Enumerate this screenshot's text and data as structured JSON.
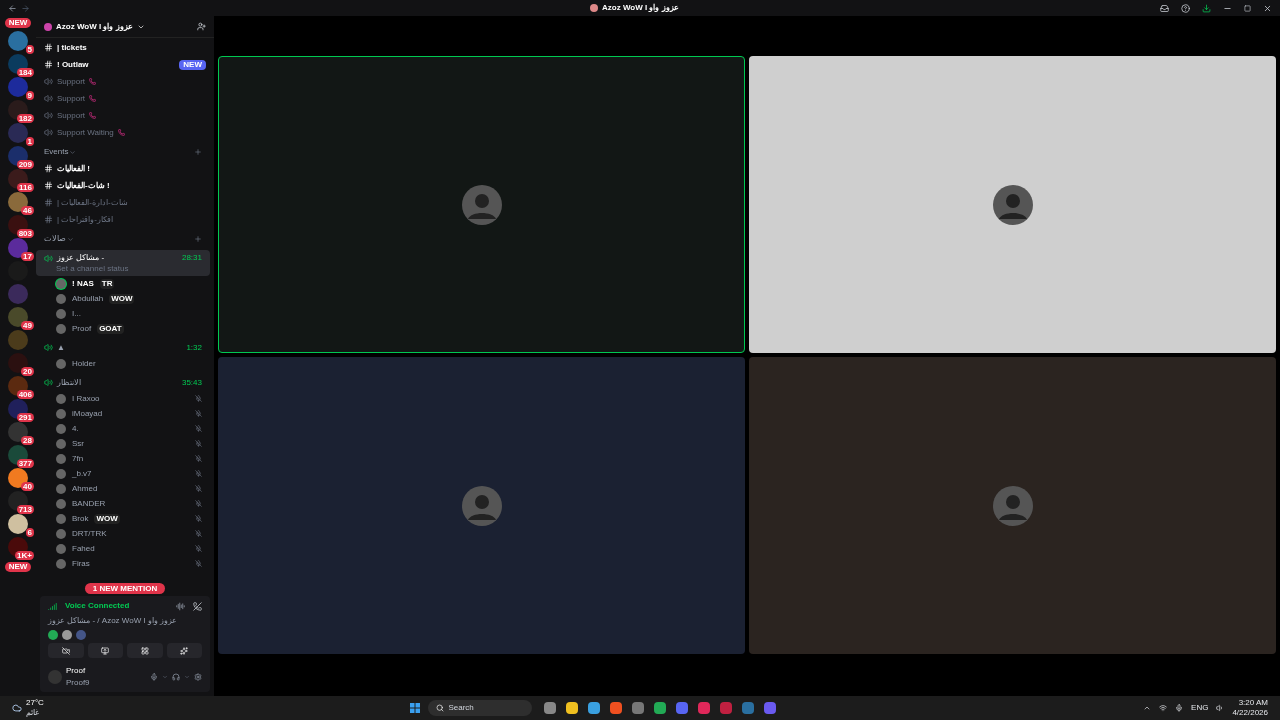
{
  "window": {
    "title": "Azoz WoW I عزوز واو"
  },
  "rail": {
    "top_pill": "NEW",
    "bottom_pill": "NEW",
    "servers": [
      {
        "kind": "badged",
        "badge": "5"
      },
      {
        "kind": "badged",
        "badge": "184"
      },
      {
        "kind": "badged",
        "badge": "9"
      },
      {
        "kind": "badged",
        "badge": "182"
      },
      {
        "kind": "badged",
        "badge": "1"
      },
      {
        "kind": "badged",
        "badge": "209"
      },
      {
        "kind": "badged",
        "badge": "116"
      },
      {
        "kind": "badged",
        "badge": "46"
      },
      {
        "kind": "badged",
        "badge": "803"
      },
      {
        "kind": "badged",
        "badge": "17"
      },
      {
        "kind": "plain"
      },
      {
        "kind": "plain"
      },
      {
        "kind": "badged",
        "badge": "49"
      },
      {
        "kind": "plain"
      },
      {
        "kind": "badged",
        "badge": "20"
      },
      {
        "kind": "badged",
        "badge": "406"
      },
      {
        "kind": "badged",
        "badge": "291"
      },
      {
        "kind": "badged",
        "badge": "28"
      },
      {
        "kind": "badged",
        "badge": "377"
      },
      {
        "kind": "badged",
        "badge": "40"
      },
      {
        "kind": "badged",
        "badge": "713"
      },
      {
        "kind": "badged",
        "badge": "6"
      },
      {
        "kind": "badged",
        "badge": "1K+"
      }
    ]
  },
  "server_header": {
    "name": "Azoz WoW I عزوز واو"
  },
  "channels": [
    {
      "kind": "text",
      "name": "| tickets",
      "unread": true
    },
    {
      "kind": "text",
      "name": "! Outlaw",
      "unread": true,
      "badge": "NEW"
    },
    {
      "kind": "voice",
      "name": "Support",
      "unread": false
    },
    {
      "kind": "voice",
      "name": "Support",
      "unread": false
    },
    {
      "kind": "voice",
      "name": "Support",
      "unread": false
    },
    {
      "kind": "voice",
      "name": "Support Waiting",
      "unread": false
    },
    {
      "kind": "category",
      "name": "Events"
    },
    {
      "kind": "text",
      "name": "الفعاليات !",
      "unread": true
    },
    {
      "kind": "text",
      "name": "شات-الفعاليات !",
      "unread": true
    },
    {
      "kind": "text",
      "name": "| شات-ادارة-الفعاليات",
      "unread": false
    },
    {
      "kind": "text",
      "name": "| افكار-واقتراحات",
      "unread": false
    },
    {
      "kind": "category",
      "name": "صالات"
    },
    {
      "kind": "voicelive",
      "name": "مشاكل عزوز -",
      "timer": "28:31",
      "selected": true,
      "status": "Set a channel status",
      "users": [
        {
          "name": "! NAS",
          "tag": "TR",
          "muted": false,
          "speaking": true
        },
        {
          "name": "Abdullah",
          "tag": "WOW",
          "muted": false,
          "speaking": false
        },
        {
          "name": "I...",
          "muted": false,
          "speaking": false
        },
        {
          "name": "Proof",
          "tag": "GOAT",
          "muted": false,
          "speaking": false
        }
      ]
    },
    {
      "kind": "voicelive",
      "name": "▲",
      "timer": "1:32",
      "selected": false,
      "users": [
        {
          "name": "Holder",
          "muted": false,
          "speaking": false
        }
      ]
    },
    {
      "kind": "voicelive",
      "name": "الانتظار",
      "timer": "35:43",
      "selected": false,
      "users": [
        {
          "name": "I Raxoo",
          "muted": true,
          "speaking": false
        },
        {
          "name": "iMoayad",
          "muted": true,
          "speaking": false
        },
        {
          "name": "4.",
          "muted": true,
          "speaking": false
        },
        {
          "name": "Ssr",
          "muted": true,
          "speaking": false
        },
        {
          "name": "7fn",
          "muted": true,
          "speaking": false
        },
        {
          "name": "_b.v7",
          "muted": true,
          "speaking": false
        },
        {
          "name": "Ahmed",
          "muted": true,
          "speaking": false
        },
        {
          "name": "BANDER",
          "muted": true,
          "speaking": false
        },
        {
          "name": "Brok",
          "tag": "WOW",
          "muted": true,
          "speaking": false
        },
        {
          "name": "DRT/TRK",
          "muted": true,
          "speaking": false
        },
        {
          "name": "Fahed",
          "muted": true,
          "speaking": false
        },
        {
          "name": "Firas",
          "muted": true,
          "speaking": false
        }
      ]
    }
  ],
  "mention_pill": "1 NEW MENTION",
  "voice_panel": {
    "status": "Voice Connected",
    "location": "مشاكل عزوز - / Azoz WoW I عزوز واو"
  },
  "user_panel": {
    "name": "Proof",
    "status": "Proof9"
  },
  "tiles": [
    {
      "color": "#121715",
      "speaking": true
    },
    {
      "color": "#cfcfcf",
      "speaking": false
    },
    {
      "color": "#1b2132",
      "speaking": false
    },
    {
      "color": "#2b2420",
      "speaking": false
    }
  ],
  "taskbar": {
    "temperature": "27°C",
    "weather": "غائم",
    "search": "Search",
    "language": "ENG",
    "time": "3:20 AM",
    "date": "4/22/2026"
  }
}
